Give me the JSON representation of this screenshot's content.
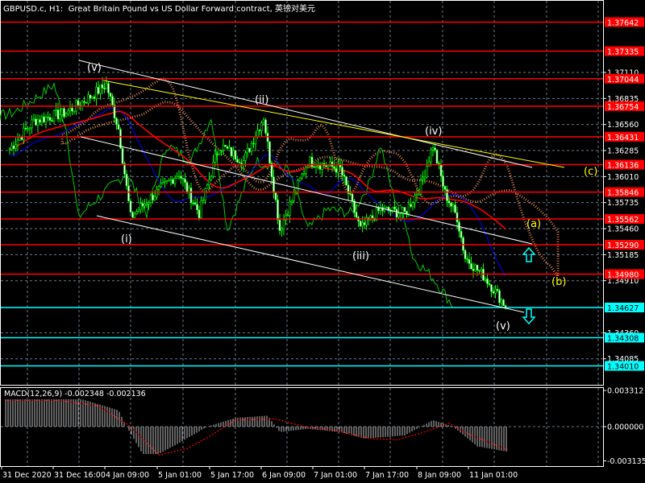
{
  "header": {
    "title": "GBPUSD.c, H1:  Great Britain Pound vs US Dollar Forward contract, 英镑对美元"
  },
  "colors": {
    "background": "#000000",
    "candle": "#00ff00",
    "level_red": "#ff0000",
    "level_cyan": "#00ffff",
    "ma": "#ff0000",
    "kijun": "#0000ff",
    "chikou": "#00cc00",
    "cloud": "#ff9966",
    "trend": "#ffffff",
    "trend_yellow": "#ffff00",
    "macd_hist": "#c0c0c0",
    "macd_signal": "#ff0000"
  },
  "chart_data": {
    "type": "candlestick",
    "symbol": "GBPUSD.c",
    "timeframe": "H1",
    "price_axis": {
      "ticks": [
        "1.37110",
        "1.36835",
        "1.36560",
        "1.36285",
        "1.36010",
        "1.35735",
        "1.35460",
        "1.35185",
        "1.34910",
        "1.34360",
        "1.34085"
      ],
      "range": [
        1.3385,
        1.3785
      ]
    },
    "time_axis": {
      "ticks": [
        "31 Dec 2020",
        "31 Dec 16:00",
        "4 Jan 09:00",
        "5 Jan 01:00",
        "5 Jan 17:00",
        "6 Jan 09:00",
        "7 Jan 01:00",
        "7 Jan 17:00",
        "8 Jan 09:00",
        "11 Jan 01:00"
      ]
    },
    "price_path": [
      [
        4,
        1.36302
      ],
      [
        16,
        1.366
      ],
      [
        32,
        1.36685
      ],
      [
        44,
        1.36855
      ],
      [
        52,
        1.36982
      ],
      [
        58,
        1.36515
      ],
      [
        64,
        1.35579
      ],
      [
        72,
        1.35749
      ],
      [
        88,
        1.36047
      ],
      [
        98,
        1.35622
      ],
      [
        108,
        1.36345
      ],
      [
        120,
        1.36175
      ],
      [
        130,
        1.36642
      ],
      [
        138,
        1.35452
      ],
      [
        152,
        1.36175
      ],
      [
        168,
        1.3609
      ],
      [
        178,
        1.35452
      ],
      [
        188,
        1.35664
      ],
      [
        200,
        1.35622
      ],
      [
        208,
        1.35919
      ],
      [
        214,
        1.36345
      ],
      [
        220,
        1.35834
      ],
      [
        226,
        1.35579
      ],
      [
        230,
        1.35154
      ],
      [
        240,
        1.34941
      ],
      [
        250,
        1.34644
      ]
    ],
    "levels_red": [
      "1.37642",
      "1.37335",
      "1.37044",
      "1.36754",
      "1.36431",
      "1.36136",
      "1.35846",
      "1.35562",
      "1.35290",
      "1.34980"
    ],
    "levels_cyan": [
      "1.34627",
      "1.34308",
      "1.34010"
    ],
    "wave_labels": [
      {
        "text": "(v)",
        "color": "#ffffff"
      },
      {
        "text": "(ii)",
        "color": "#ffffff"
      },
      {
        "text": "(iv)",
        "color": "#ffffff"
      },
      {
        "text": "(i)",
        "color": "#ffffff"
      },
      {
        "text": "(iii)",
        "color": "#ffffff"
      },
      {
        "text": "(v)",
        "color": "#ffffff"
      },
      {
        "text": "(c)",
        "color": "#ffff00"
      },
      {
        "text": "(a)",
        "color": "#ffff00"
      },
      {
        "text": "(b)",
        "color": "#ffff00"
      }
    ],
    "arrows": [
      {
        "direction": "up",
        "color": "#00ffff"
      },
      {
        "direction": "down",
        "color": "#00ffff"
      }
    ],
    "macd": {
      "label": "MACD(12,26,9) -0.002348 -0.002136",
      "ticks": [
        "0.003312",
        "0.000000",
        "-0.003135"
      ],
      "range": [
        -0.003135,
        0.003312
      ],
      "histogram": [
        [
          2,
          0.0025
        ],
        [
          40,
          0.0025
        ],
        [
          58,
          0.0015
        ],
        [
          62,
          0
        ],
        [
          70,
          -0.0025
        ],
        [
          78,
          -0.0025
        ],
        [
          88,
          -0.0015
        ],
        [
          102,
          0
        ],
        [
          116,
          0.0008
        ],
        [
          132,
          0.001
        ],
        [
          138,
          -0.0005
        ],
        [
          152,
          -0.0002
        ],
        [
          168,
          -0.0005
        ],
        [
          180,
          -0.0011
        ],
        [
          200,
          -0.0008
        ],
        [
          208,
          0
        ],
        [
          214,
          0.0006
        ],
        [
          224,
          0
        ],
        [
          236,
          -0.0018
        ],
        [
          251,
          -0.0023
        ]
      ],
      "signal": [
        [
          2,
          0.0024
        ],
        [
          28,
          0.0024
        ],
        [
          48,
          0.0019
        ],
        [
          64,
          0
        ],
        [
          78,
          -0.0026
        ],
        [
          92,
          -0.002
        ],
        [
          102,
          -0.001
        ],
        [
          116,
          0.0006
        ],
        [
          136,
          0.0007
        ],
        [
          150,
          0
        ],
        [
          164,
          -0.0003
        ],
        [
          184,
          -0.0011
        ],
        [
          196,
          -0.0012
        ],
        [
          208,
          -0.0006
        ],
        [
          222,
          0.0003
        ],
        [
          232,
          -0.0007
        ],
        [
          251,
          -0.0021
        ]
      ]
    }
  }
}
